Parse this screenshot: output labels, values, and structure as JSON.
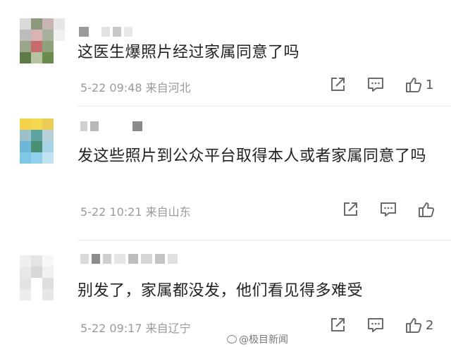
{
  "comments": [
    {
      "text": "这医生爆照片经过家属同意了吗",
      "meta": "5-22 09:48 来自河北",
      "like_count": "1"
    },
    {
      "text": "发这些照片到公众平台取得本人或者家属同意了吗",
      "meta": "5-22 10:21 来自山东",
      "like_count": ""
    },
    {
      "text": "别发了，家属都没发，他们看见得多难受",
      "meta": "5-22 09:17 来自辽宁",
      "like_count": "2"
    }
  ],
  "watermark": "@极目新闻",
  "icons": [
    "share-icon",
    "comment-icon",
    "like-icon"
  ],
  "colors": {
    "meta": "#9a9a9a",
    "icon": "#6b6b6b"
  }
}
